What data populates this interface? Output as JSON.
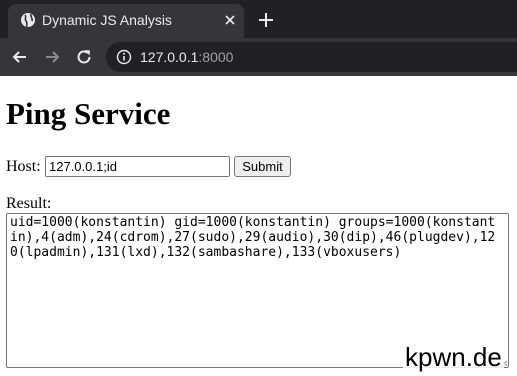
{
  "browser": {
    "tab_title": "Dynamic JS Analysis",
    "url_host": "127.0.0.1",
    "url_port": ":8000"
  },
  "page": {
    "title": "Ping Service",
    "host_label": "Host:",
    "host_value": "127.0.0.1;id",
    "submit_label": "Submit",
    "result_label": "Result:",
    "result_text": "uid=1000(konstantin) gid=1000(konstantin) groups=1000(konstantin),4(adm),24(cdrom),27(sudo),29(audio),30(dip),46(plugdev),120(lpadmin),131(lxd),132(sambashare),133(vboxusers)"
  },
  "watermark": "kpwn.de",
  "colors": {
    "chrome_dark": "#202124",
    "chrome_tab": "#35363a",
    "chrome_text": "#e8eaed",
    "chrome_text_muted": "#9aa0a6"
  }
}
